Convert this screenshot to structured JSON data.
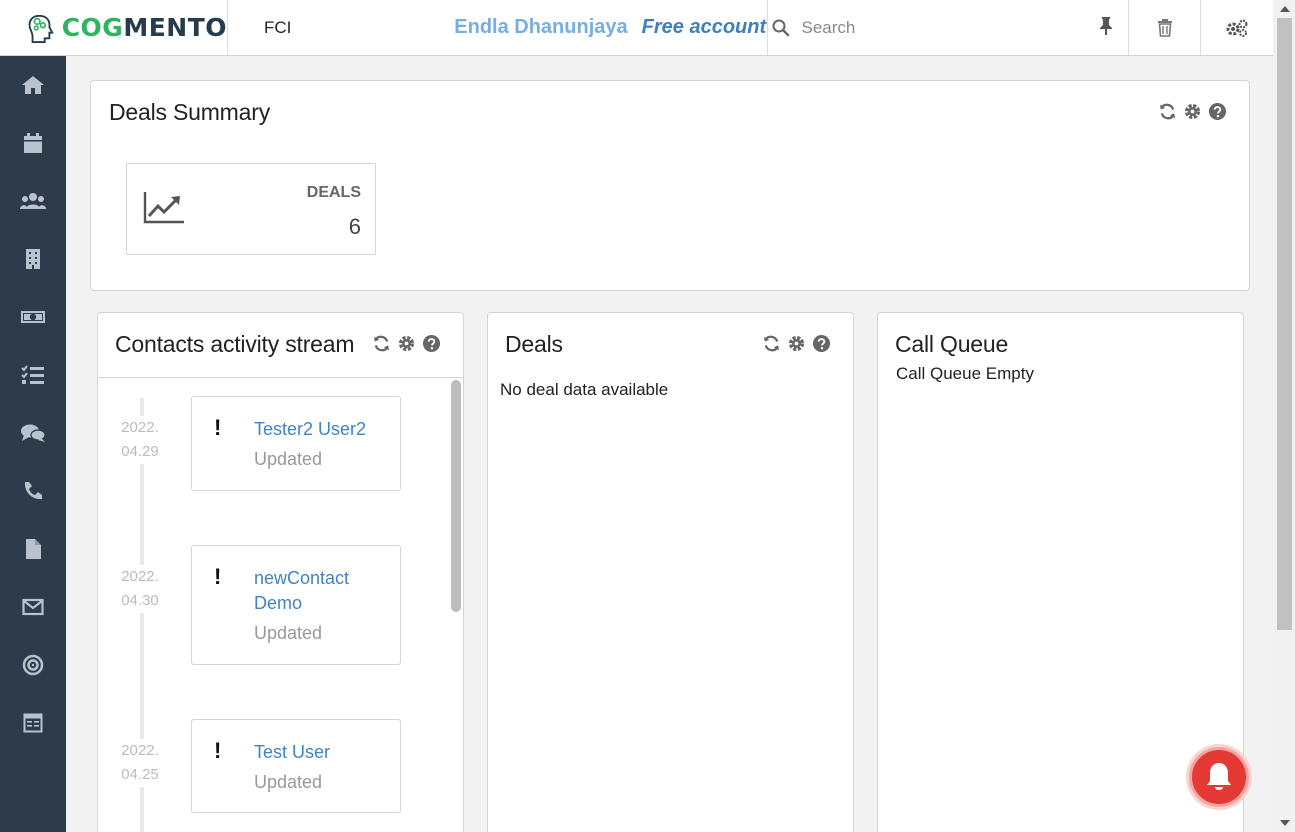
{
  "header": {
    "logo_text_left": "COG",
    "logo_text_right": "MENTO",
    "company": "FCI",
    "user_name": "Endla Dhanunjaya",
    "account_type": "Free account",
    "search_placeholder": "Search"
  },
  "sidebar": {
    "items": [
      {
        "icon": "home-icon"
      },
      {
        "icon": "calendar-icon"
      },
      {
        "icon": "contacts-icon"
      },
      {
        "icon": "companies-icon"
      },
      {
        "icon": "deals-icon"
      },
      {
        "icon": "tasks-icon"
      },
      {
        "icon": "cases-icon"
      },
      {
        "icon": "calls-icon"
      },
      {
        "icon": "documents-icon"
      },
      {
        "icon": "email-icon"
      },
      {
        "icon": "campaigns-icon"
      },
      {
        "icon": "forms-icon"
      }
    ]
  },
  "deals_summary": {
    "title": "Deals Summary",
    "stat_label": "DEALS",
    "stat_value": "6"
  },
  "activity": {
    "title": "Contacts activity stream",
    "entries": [
      {
        "date_year": "2022.",
        "date_md": "04.29",
        "name": "Tester2 User2",
        "status": "Updated"
      },
      {
        "date_year": "2022.",
        "date_md": "04.30",
        "name": "newContact Demo",
        "status": "Updated"
      },
      {
        "date_year": "2022.",
        "date_md": "04.25",
        "name": "Test User",
        "status": "Updated"
      }
    ]
  },
  "deals": {
    "title": "Deals",
    "empty_text": "No deal data available"
  },
  "call_queue": {
    "title": "Call Queue",
    "empty_text": "Call Queue Empty"
  },
  "colors": {
    "sidebar_bg": "#2e3b4a",
    "brand_green": "#2fb35f",
    "link_blue": "#4183c4",
    "notification_red": "#e53935"
  }
}
